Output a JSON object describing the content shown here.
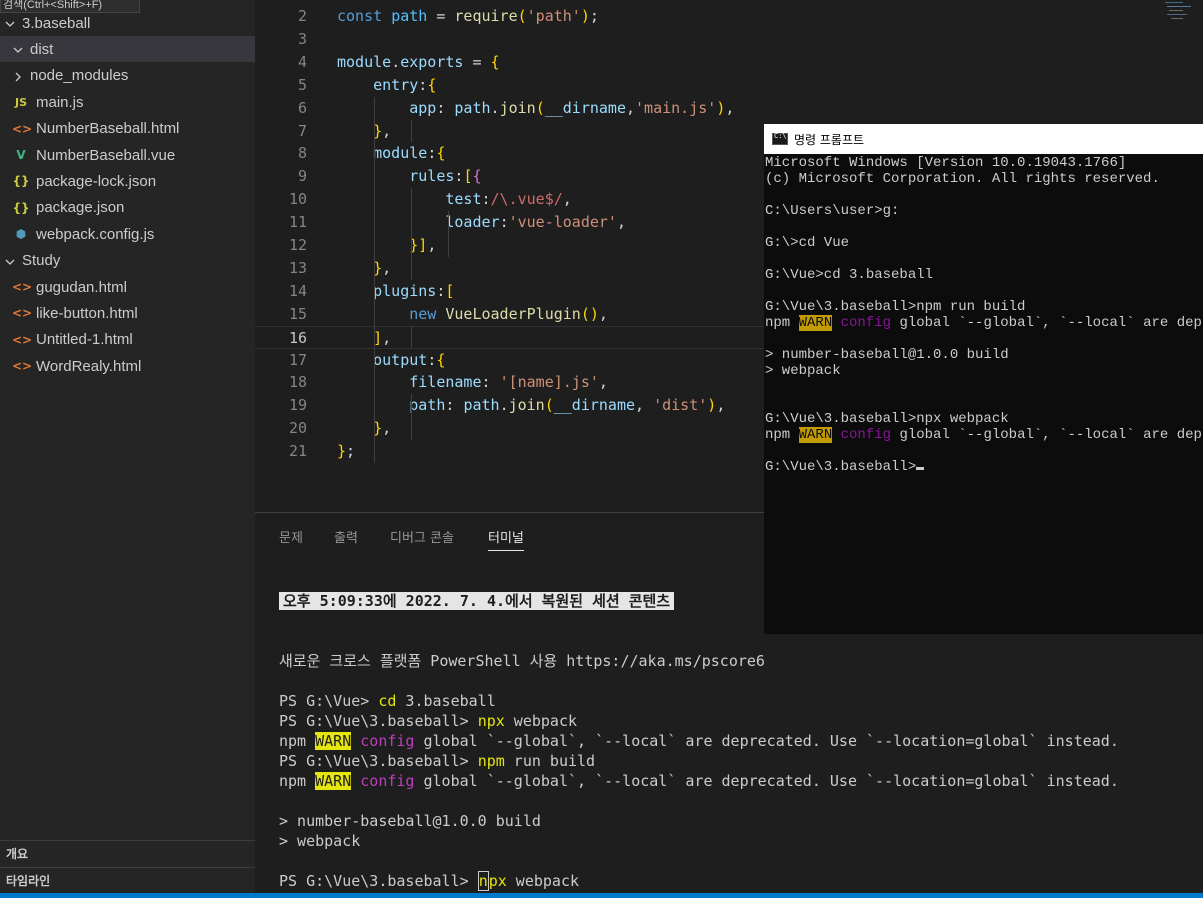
{
  "search_tooltip": "검색(Ctrl+<Shift>+F)",
  "sidebar": {
    "items": [
      {
        "label": "3.baseball",
        "kind": "folder",
        "open": true,
        "level": 0
      },
      {
        "label": "dist",
        "kind": "folder",
        "open": true,
        "level": 1,
        "selected": true
      },
      {
        "label": "node_modules",
        "kind": "folder",
        "open": false,
        "level": 1
      },
      {
        "label": "main.js",
        "kind": "js",
        "level": 1
      },
      {
        "label": "NumberBaseball.html",
        "kind": "html",
        "level": 1
      },
      {
        "label": "NumberBaseball.vue",
        "kind": "vue",
        "level": 1
      },
      {
        "label": "package-lock.json",
        "kind": "json",
        "level": 1
      },
      {
        "label": "package.json",
        "kind": "json",
        "level": 1
      },
      {
        "label": "webpack.config.js",
        "kind": "config",
        "level": 1
      },
      {
        "label": "Study",
        "kind": "folder",
        "open": true,
        "level": 0
      },
      {
        "label": "gugudan.html",
        "kind": "html",
        "level": 1
      },
      {
        "label": "like-button.html",
        "kind": "html",
        "level": 1
      },
      {
        "label": "Untitled-1.html",
        "kind": "html",
        "level": 1
      },
      {
        "label": "WordRealy.html",
        "kind": "html",
        "level": 1
      }
    ],
    "outline_label": "개요",
    "timeline_label": "타임라인"
  },
  "editor": {
    "current_line": 16,
    "lines": [
      {
        "n": "2",
        "code": "const path = require('path');"
      },
      {
        "n": "3",
        "code": ""
      },
      {
        "n": "4",
        "code": "module.exports = {"
      },
      {
        "n": "5",
        "code": "    entry:{"
      },
      {
        "n": "6",
        "code": "        app: path.join(__dirname,'main.js'),"
      },
      {
        "n": "7",
        "code": "    },"
      },
      {
        "n": "8",
        "code": "    module:{"
      },
      {
        "n": "9",
        "code": "        rules:[{"
      },
      {
        "n": "10",
        "code": "            test:/\\.vue$/,"
      },
      {
        "n": "11",
        "code": "            loader:'vue-loader',"
      },
      {
        "n": "12",
        "code": "        }],"
      },
      {
        "n": "13",
        "code": "    },"
      },
      {
        "n": "14",
        "code": "    plugins:["
      },
      {
        "n": "15",
        "code": "        new VueLoaderPlugin(),"
      },
      {
        "n": "16",
        "code": "    ],"
      },
      {
        "n": "17",
        "code": "    output:{"
      },
      {
        "n": "18",
        "code": "        filename: '[name].js',"
      },
      {
        "n": "19",
        "code": "        path: path.join(__dirname, 'dist'),"
      },
      {
        "n": "20",
        "code": "    },"
      },
      {
        "n": "21",
        "code": "};"
      }
    ]
  },
  "panel": {
    "tabs": [
      {
        "label": "문제",
        "active": false
      },
      {
        "label": "출력",
        "active": false
      },
      {
        "label": "디버그 콘솔",
        "active": false
      },
      {
        "label": "터미널",
        "active": true
      }
    ],
    "terminal": {
      "restored": "오후 5:09:33에 2022. 7. 4.에서 복원된 세션 콘텐츠",
      "powershell_notice": "새로운 크로스 플랫폼 PowerShell 사용 https://aka.ms/pscore6",
      "prompt1": "PS G:\\Vue> ",
      "cmd1": "cd",
      "arg1": " 3.baseball",
      "prompt2": "PS G:\\Vue\\3.baseball> ",
      "cmd2": "npx",
      "arg2": " webpack",
      "warn_prefix": "npm ",
      "warn_tag": "WARN",
      "warn_config": "config",
      "warn_text": " global `--global`, `--local` are deprecated. Use `--location=global` instead.",
      "prompt3": "PS G:\\Vue\\3.baseball> ",
      "cmd3": "npm",
      "arg3": " run build",
      "build1": "> number-baseball@1.0.0 build",
      "build2": "> webpack",
      "prompt4": "PS G:\\Vue\\3.baseball> ",
      "cmd4_first": "n",
      "cmd4_rest": "px",
      "arg4": " webpack"
    }
  },
  "cmd": {
    "title": "명령 프롬프트",
    "line1": "Microsoft Windows [Version 10.0.19043.1766]",
    "line2": "(c) Microsoft Corporation. All rights reserved.",
    "line3": "C:\\Users\\user>g:",
    "line4": "G:\\>cd Vue",
    "line5": "G:\\Vue>cd 3.baseball",
    "line6": "G:\\Vue\\3.baseball>npm run build",
    "warn_prefix": "npm ",
    "warn_tag": "WARN",
    "warn_config": "config",
    "warn_text": " global `--global`, `--local` are deprec",
    "line8": "> number-baseball@1.0.0 build",
    "line9": "> webpack",
    "line10": "G:\\Vue\\3.baseball>npx webpack",
    "line12": "G:\\Vue\\3.baseball>"
  },
  "colors": {
    "sidebar_bg": "#252526",
    "editor_bg": "#1e1e1e",
    "statusbar": "#007acc",
    "warn_highlight": "#e5e510",
    "cmd_bg": "#0c0c0c"
  }
}
